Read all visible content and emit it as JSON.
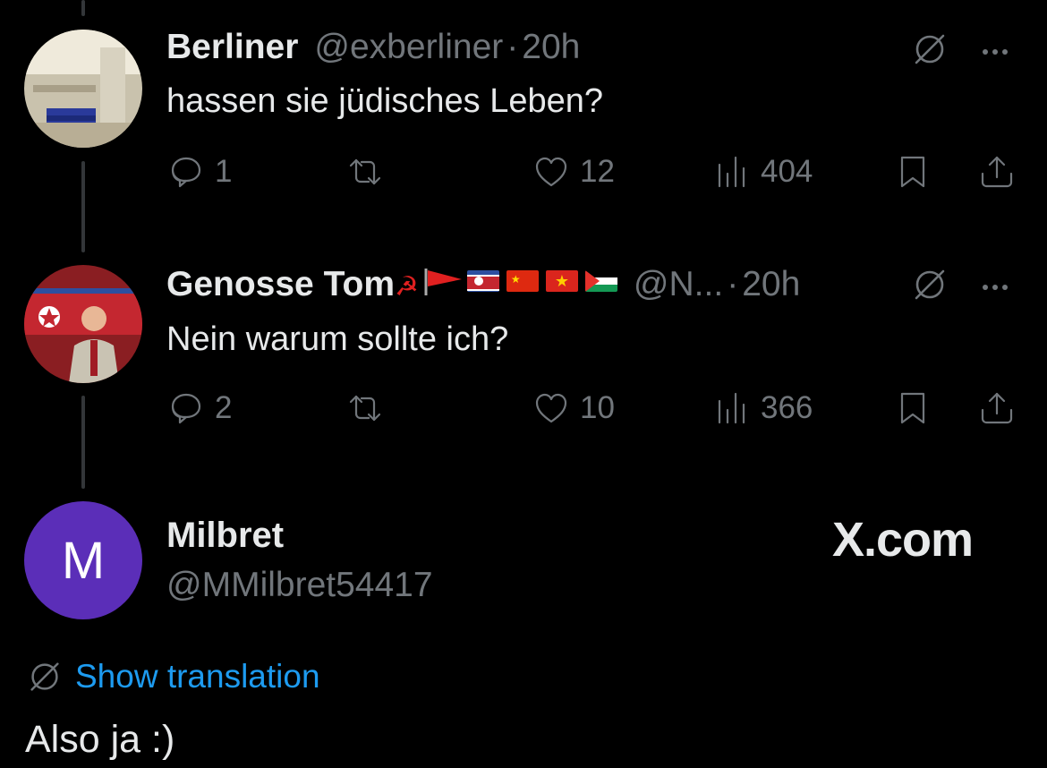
{
  "tweets": [
    {
      "name": "Berliner",
      "handle": "@exberliner",
      "separator": "·",
      "time": "20h",
      "text": "hassen sie jüdisches Leben?",
      "replies": "1",
      "likes": "12",
      "views": "404"
    },
    {
      "name": "Genosse Tom",
      "name_emoji": "☭",
      "handle": "@N...",
      "separator": "·",
      "time": "20h",
      "text": "Nein warum sollte ich?",
      "replies": "2",
      "likes": "10",
      "views": "366"
    }
  ],
  "main": {
    "avatar_letter": "M",
    "name": "Milbret",
    "handle": "@MMilbret54417",
    "watermark": "X.com",
    "show_translation": "Show translation",
    "text": "Also ja :)"
  },
  "colors": {
    "background": "#000000",
    "text": "#e7e9ea",
    "muted": "#71767b",
    "link": "#1d9bf0",
    "avatar_purple": "#5b2eb8",
    "thread_line": "#333639"
  },
  "icons": [
    "reply-icon",
    "retweet-icon",
    "like-icon",
    "views-icon",
    "bookmark-icon",
    "share-icon",
    "translate-icon",
    "more-icon"
  ]
}
